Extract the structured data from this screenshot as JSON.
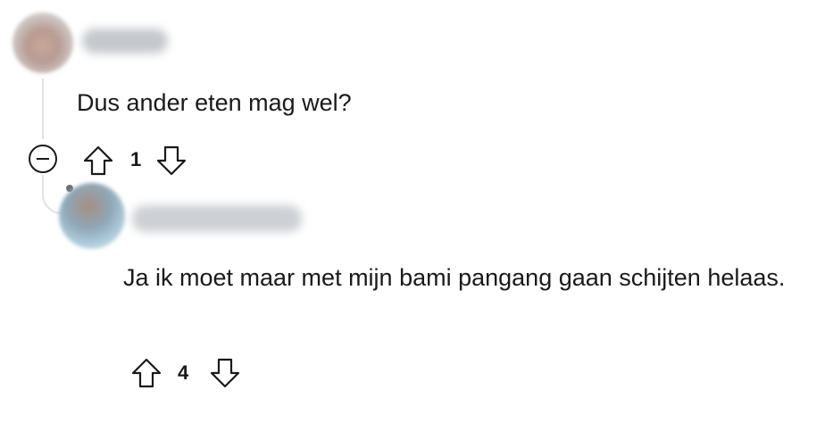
{
  "comments": [
    {
      "author": "",
      "text": "Dus ander eten mag wel?",
      "score": "1",
      "collapse_icon": "collapse-minus-icon",
      "upvote_icon": "arrow-up-icon",
      "downvote_icon": "arrow-down-icon"
    },
    {
      "author": "",
      "text": "Ja ik moet maar met mijn bami pangang gaan schijten helaas.",
      "score": "4",
      "upvote_icon": "arrow-up-icon",
      "downvote_icon": "arrow-down-icon"
    }
  ],
  "colors": {
    "text": "#1a1a1b",
    "thread_line": "#e1e3e6",
    "icon": "#1a1a1b"
  }
}
